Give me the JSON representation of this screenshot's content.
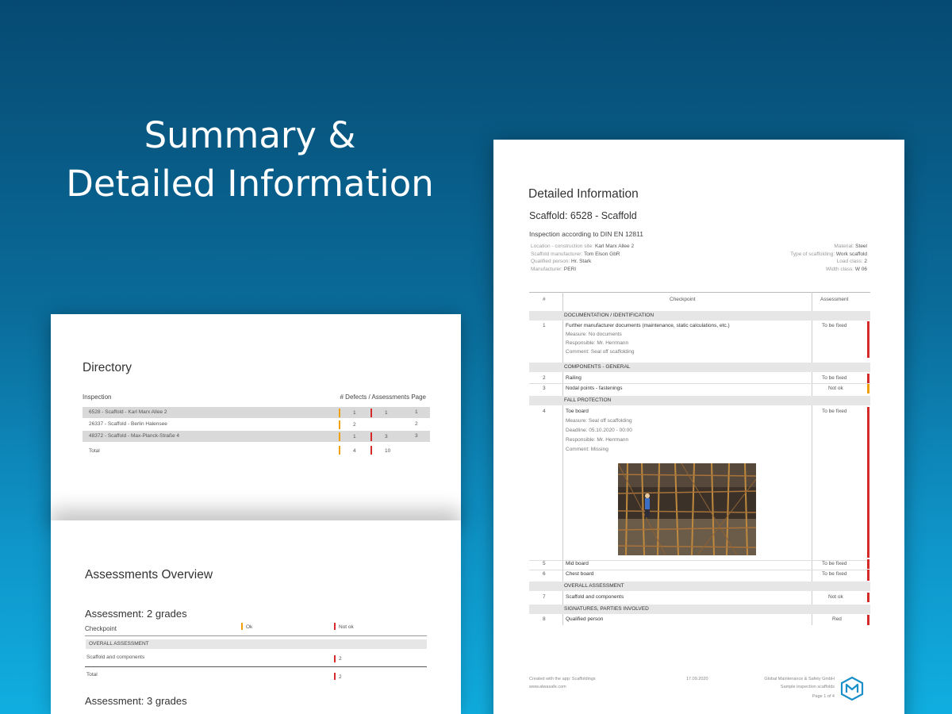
{
  "headline": {
    "line1": "Summary &",
    "line2": "Detailed Information"
  },
  "directory": {
    "title": "Directory",
    "col_inspection": "Inspection",
    "col_right": "# Defects / Assessments  Page",
    "rows": [
      {
        "name": "6528 - Scaffold - Karl Marx Allee 2",
        "a": "1",
        "b": "1",
        "page": "1"
      },
      {
        "name": "26337 - Scaffold - Berlin Halensee",
        "a": "2",
        "b": "",
        "page": "2"
      },
      {
        "name": "48372 - Scaffold - Max-Planck-Straße 4",
        "a": "1",
        "b": "3",
        "page": "3"
      }
    ],
    "total_label": "Total",
    "total_a": "4",
    "total_b": "10"
  },
  "assessments": {
    "title": "Assessments Overview",
    "g2_title": "Assessment: 2 grades",
    "checkpoint": "Checkpoint",
    "ok": "Ok",
    "not_ok": "Not ok",
    "section": "OVERALL ASSESSMENT",
    "item": "Scaffold and components",
    "item_val": "2",
    "total": "Total",
    "total_val": "2",
    "g3_title": "Assessment: 3 grades"
  },
  "detail": {
    "title": "Detailed Information",
    "scaffold": "Scaffold: 6528 - Scaffold",
    "inspection": "Inspection according to DIN EN 12811",
    "meta_left": [
      {
        "k": "Location - construction site:",
        "v": "Karl Marx Allee 2"
      },
      {
        "k": "Scaffold manufacturer:",
        "v": "Tom Elson GbR"
      },
      {
        "k": "Qualified person:",
        "v": "Hr. Stark"
      },
      {
        "k": "Manufacturer:",
        "v": "PERI"
      }
    ],
    "meta_right": [
      {
        "k": "Material:",
        "v": "Steel"
      },
      {
        "k": "Type of scaffolding:",
        "v": "Work scaffold"
      },
      {
        "k": "Load class:",
        "v": "2"
      },
      {
        "k": "Width class:",
        "v": "W 06"
      }
    ],
    "h_num": "#",
    "h_checkpoint": "Checkpoint",
    "h_assessment": "Assessment",
    "sec1": "DOCUMENTATION / IDENTIFICATION",
    "r1_num": "1",
    "r1_text": "Further manufacturer documents (maintenance, static calculations, etc.)",
    "r1_val": "To be fixed",
    "r1_measure": "Measure: No documents",
    "r1_resp": "Responsible: Mr. Herrmann",
    "r1_comment": "Comment: Seal off scaffolding",
    "sec2": "COMPONENTS - GENERAL",
    "r2_num": "2",
    "r2_text": "Railing",
    "r2_val": "To be fixed",
    "r3_num": "3",
    "r3_text": "Nodal points - fastenings",
    "r3_val": "Not ok",
    "sec3": "FALL PROTECTION",
    "r4_num": "4",
    "r4_text": "Toe board",
    "r4_val": "To be fixed",
    "r4_measure": "Measure: Seal off scaffolding",
    "r4_deadline": "Deadline: 05.10.2020 - 00:00",
    "r4_resp": "Responsible: Mr. Herrmann",
    "r4_comment": "Comment: Missing",
    "r5_num": "5",
    "r5_text": "Mid board",
    "r5_val": "To be fixed",
    "r6_num": "6",
    "r6_text": "Chest board",
    "r6_val": "To be fixed",
    "sec4": "OVERALL ASSESSMENT",
    "r7_num": "7",
    "r7_text": "Scaffold and components",
    "r7_val": "Not ok",
    "sec5": "SIGNATURES, PARTIES INVOLVED",
    "r8_num": "8",
    "r8_text": "Qualified person",
    "r8_val": "Red",
    "footer_left1": "Created with the app: Scaffoldings",
    "footer_left2": "www.alwasafe.com",
    "footer_date": "17.09.2020",
    "footer_right1": "Global Maintenance & Safety GmbH",
    "footer_right2": "Sample inspection scaffolds",
    "footer_page": "Page 1 of 4",
    "colors": {
      "red": "#d42a2a",
      "orange": "#f0a000"
    }
  }
}
